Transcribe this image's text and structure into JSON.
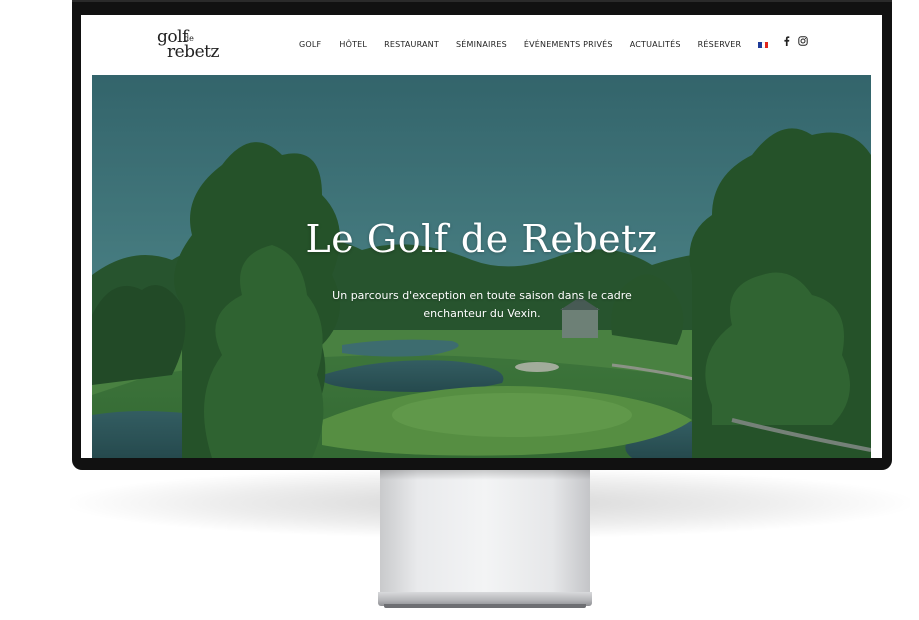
{
  "site": {
    "logo": {
      "line1": "golf",
      "line2": "de",
      "line3": "rebetz"
    },
    "nav": {
      "items": [
        {
          "label": "GOLF"
        },
        {
          "label": "HÔTEL"
        },
        {
          "label": "RESTAURANT"
        },
        {
          "label": "SÉMINAIRES"
        },
        {
          "label": "ÉVÉNEMENTS PRIVÉS"
        },
        {
          "label": "ACTUALITÉS"
        },
        {
          "label": "RÉSERVER"
        }
      ],
      "language_flag": "french-flag-icon",
      "flag_colors": [
        "#1f3c99",
        "#ffffff",
        "#e1251b"
      ]
    },
    "social": {
      "icons": [
        "facebook-icon",
        "instagram-icon"
      ]
    },
    "hero": {
      "title": "Le Golf de Rebetz",
      "subtitle": "Un parcours d'exception en toute saison dans le cadre enchanteur du Vexin."
    }
  },
  "colors": {
    "monitor_bezel": "#111111",
    "text_dark": "#222222",
    "hero_text": "#ffffff"
  }
}
